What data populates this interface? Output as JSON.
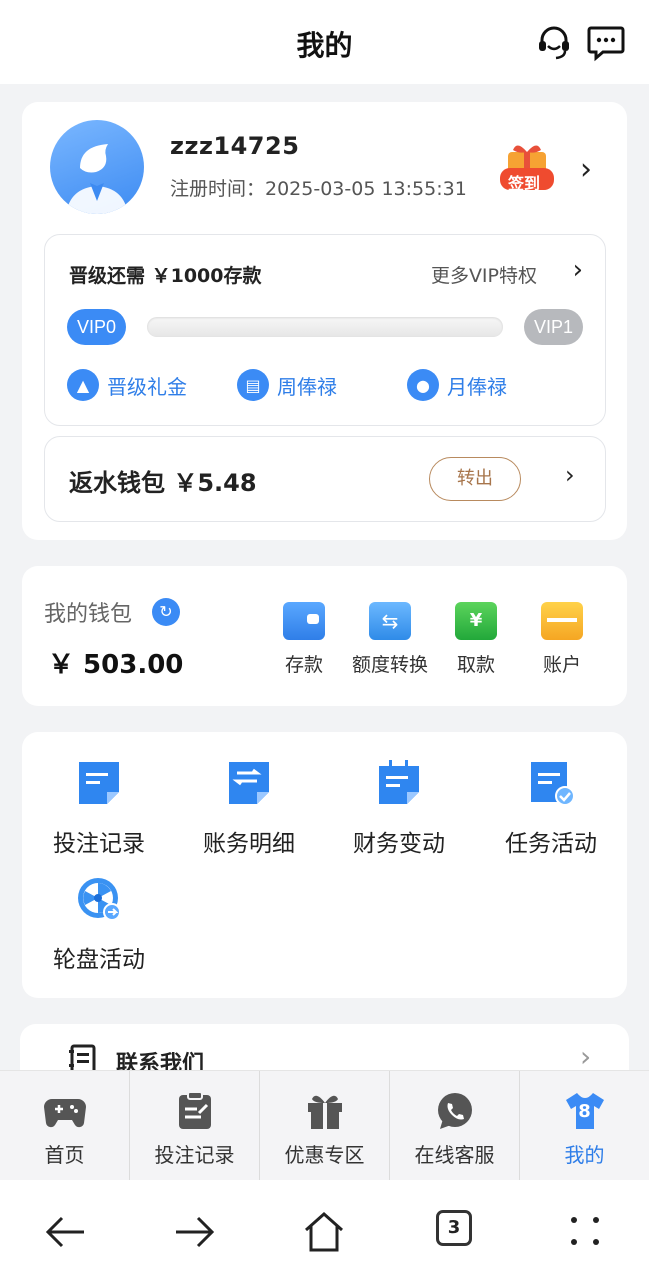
{
  "header": {
    "title": "我的"
  },
  "profile": {
    "username": "zzz14725",
    "reg_time": "注册时间：2025-03-05 13:55:31",
    "sign_badge": "签到"
  },
  "vip": {
    "upgrade_need": "晋级还需 ￥1000存款",
    "more_privileges": "更多VIP特权",
    "current_level": "VIP0",
    "next_level": "VIP1",
    "progress": 0,
    "perks": [
      "晋级礼金",
      "周俸禄",
      "月俸禄"
    ]
  },
  "rebate": {
    "label": "返水钱包 ￥5.48",
    "transfer_button": "转出"
  },
  "wallet": {
    "title": "我的钱包",
    "balance": "￥ 503.00",
    "actions": [
      "存款",
      "额度转换",
      "取款",
      "账户"
    ]
  },
  "features": [
    "投注记录",
    "账务明细",
    "财务变动",
    "任务活动",
    "轮盘活动"
  ],
  "contact": {
    "label": "联系我们"
  },
  "tabbar": {
    "items": [
      "首页",
      "投注记录",
      "优惠专区",
      "在线客服",
      "我的"
    ],
    "badge": "8"
  },
  "system_nav": {
    "tab_count": "3"
  },
  "colors": {
    "accent": "#3b8bf5",
    "transfer": "#b88a5e",
    "background": "#f2f3f5"
  }
}
